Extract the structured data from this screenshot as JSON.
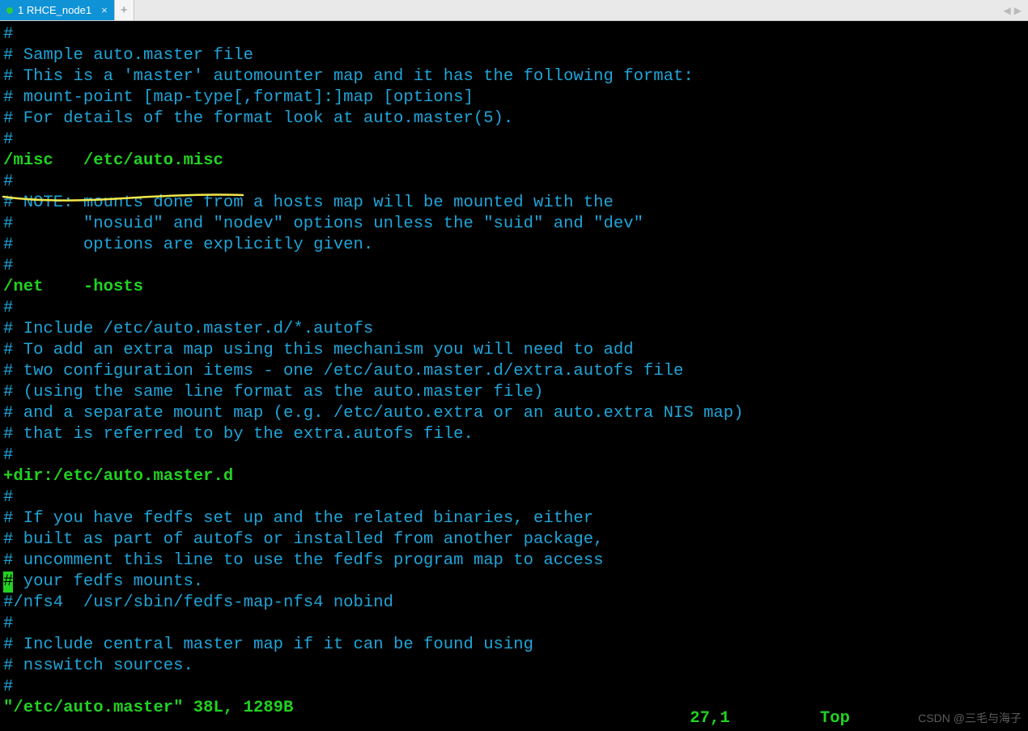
{
  "tabbar": {
    "active_tab_label": "1 RHCE_node1",
    "close_glyph": "×",
    "new_tab_glyph": "+",
    "nav_left_glyph": "◀",
    "nav_right_glyph": "▶"
  },
  "editor": {
    "filename": "/etc/auto.master",
    "hash": "#",
    "lines": {
      "l1": "#",
      "l2": "# Sample auto.master file",
      "l3": "# This is a 'master' automounter map and it has the following format:",
      "l4": "# mount-point [map-type[,format]:]map [options]",
      "l5": "# For details of the format look at auto.master(5).",
      "l6": "#",
      "l7": "/misc   /etc/auto.misc",
      "l8": "#",
      "l9": "# NOTE: mounts done from a hosts map will be mounted with the",
      "l10": "#       \"nosuid\" and \"nodev\" options unless the \"suid\" and \"dev\"",
      "l11": "#       options are explicitly given.",
      "l12": "#",
      "l13": "/net    -hosts",
      "l14": "#",
      "l15": "# Include /etc/auto.master.d/*.autofs",
      "l16": "# To add an extra map using this mechanism you will need to add",
      "l17": "# two configuration items - one /etc/auto.master.d/extra.autofs file",
      "l18": "# (using the same line format as the auto.master file)",
      "l19": "# and a separate mount map (e.g. /etc/auto.extra or an auto.extra NIS map)",
      "l20": "# that is referred to by the extra.autofs file.",
      "l21": "#",
      "l22": "+dir:/etc/auto.master.d",
      "l23": "#",
      "l24": "# If you have fedfs set up and the related binaries, either",
      "l25": "# built as part of autofs or installed from another package,",
      "l26": "# uncomment this line to use the fedfs program map to access",
      "l27_rest": " your fedfs mounts.",
      "l28": "#/nfs4  /usr/sbin/fedfs-map-nfs4 nobind",
      "l29": "#",
      "l30": "# Include central master map if it can be found using",
      "l31": "# nsswitch sources.",
      "l32": "#"
    },
    "status_left_filepart": "\"/etc/auto.master\" 38L, 1289B",
    "status_right_pos": "27,1",
    "status_right_mode": "Top"
  },
  "watermark": {
    "text": "CSDN @三毛与海子"
  }
}
